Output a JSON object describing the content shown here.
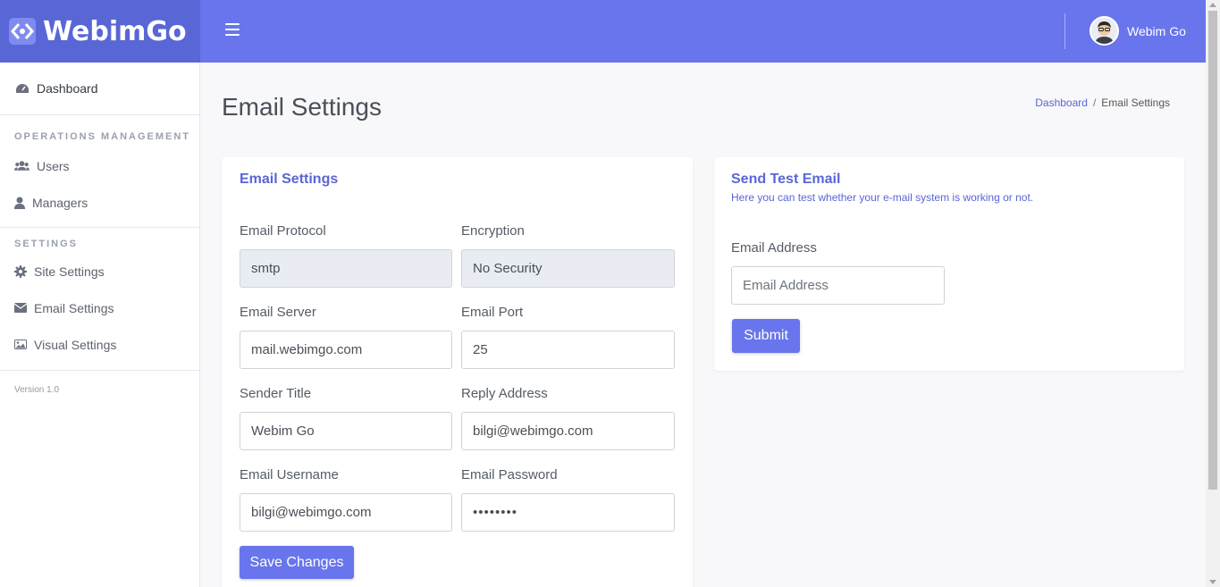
{
  "brand": {
    "name": "WebimGo"
  },
  "topbar": {
    "user_name": "Webim Go"
  },
  "sidebar": {
    "dashboard": "Dashboard",
    "section_operations": "OPERATIONS MANAGEMENT",
    "users": "Users",
    "managers": "Managers",
    "section_settings": "SETTINGS",
    "site_settings": "Site Settings",
    "email_settings": "Email Settings",
    "visual_settings": "Visual Settings",
    "version": "Version 1.0"
  },
  "page": {
    "title": "Email Settings",
    "breadcrumb_home": "Dashboard",
    "breadcrumb_sep": "/",
    "breadcrumb_current": "Email Settings"
  },
  "email_form": {
    "card_title": "Email Settings",
    "protocol_label": "Email Protocol",
    "protocol_value": "smtp",
    "encryption_label": "Encryption",
    "encryption_value": "No Security",
    "server_label": "Email Server",
    "server_value": "mail.webimgo.com",
    "port_label": "Email Port",
    "port_value": "25",
    "sender_label": "Sender Title",
    "sender_value": "Webim Go",
    "reply_label": "Reply Address",
    "reply_value": "bilgi@webimgo.com",
    "username_label": "Email Username",
    "username_value": "bilgi@webimgo.com",
    "password_label": "Email Password",
    "password_value": "••••••••",
    "save_label": "Save Changes"
  },
  "test_email": {
    "card_title": "Send Test Email",
    "subtitle": "Here you can test whether your e-mail system is working or not.",
    "address_label": "Email Address",
    "address_placeholder": "Email Address",
    "submit_label": "Submit"
  },
  "colors": {
    "accent": "#6875ec",
    "logo_bg": "#5966d6",
    "link": "#5966d6"
  }
}
